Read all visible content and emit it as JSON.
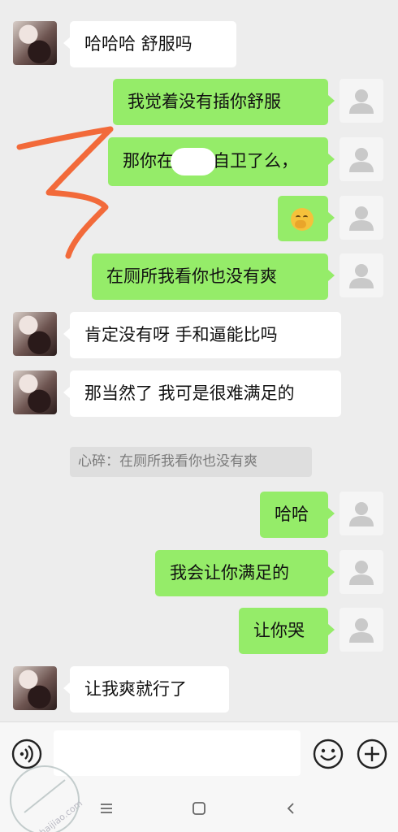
{
  "messages": {
    "m1": "哈哈哈 舒服吗",
    "m2": "我觉着没有插你舒服",
    "m3_before": "那你在",
    "m3_after": "自卫了么，",
    "m5": "在厕所我看你也没有爽",
    "m6": "肯定没有呀 手和逼能比吗",
    "m7": "那当然了  我可是很难满足的",
    "quote": "心碎：在厕所我看你也没有爽",
    "m8": "哈哈",
    "m9": "我会让你满足的",
    "m10": "让你哭",
    "m11": "让我爽就行了"
  },
  "icons": {
    "voice": "voice-icon",
    "emoji": "smiley-icon",
    "plus": "plus-icon",
    "sticker": "thinking-face-emoji",
    "nav_menu": "menu-icon",
    "nav_home": "home-square-icon",
    "nav_back": "back-chevron-icon"
  },
  "colors": {
    "sent_bubble": "#95ec69",
    "received_bubble": "#ffffff",
    "background": "#ededed",
    "scribble": "#f26a3a"
  },
  "watermark": "haijiao.com"
}
